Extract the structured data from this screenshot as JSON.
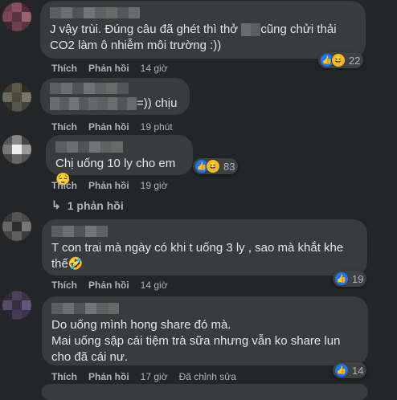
{
  "actions": {
    "like": "Thích",
    "reply": "Phản hồi"
  },
  "comments": [
    {
      "text_a": "J vậy trùi. Đúng câu đã ghét thì thở ",
      "text_b": "cũng chửi thải\nCO2 làm ô nhiễm môi trường :))",
      "time": "14 giờ",
      "reactions": 22
    },
    {
      "text_end": "=)) chịu",
      "time": "19 phút"
    },
    {
      "text": "Chị uống 10 ly cho em 😌",
      "time": "19 giờ",
      "reactions": 83
    },
    {
      "text": "T con trai mà ngày có khi t uống 3 ly , sao mà khắt khe\nthế🤣",
      "time": "14 giờ",
      "reactions": 19
    },
    {
      "text": "Do uống mình hong share đó mà.\nMai uống sập cái tiệm trà sữa nhưng vẫn ko share lun\ncho đã cái nư.",
      "time": "17 giờ",
      "edited": "Đã chỉnh sửa",
      "reactions": 14
    }
  ],
  "replies_link": "1 phản hồi",
  "colors": {
    "background": "#242526",
    "bubble": "#3a3b3c",
    "like": "#1877f2",
    "haha": "#f7b928"
  }
}
